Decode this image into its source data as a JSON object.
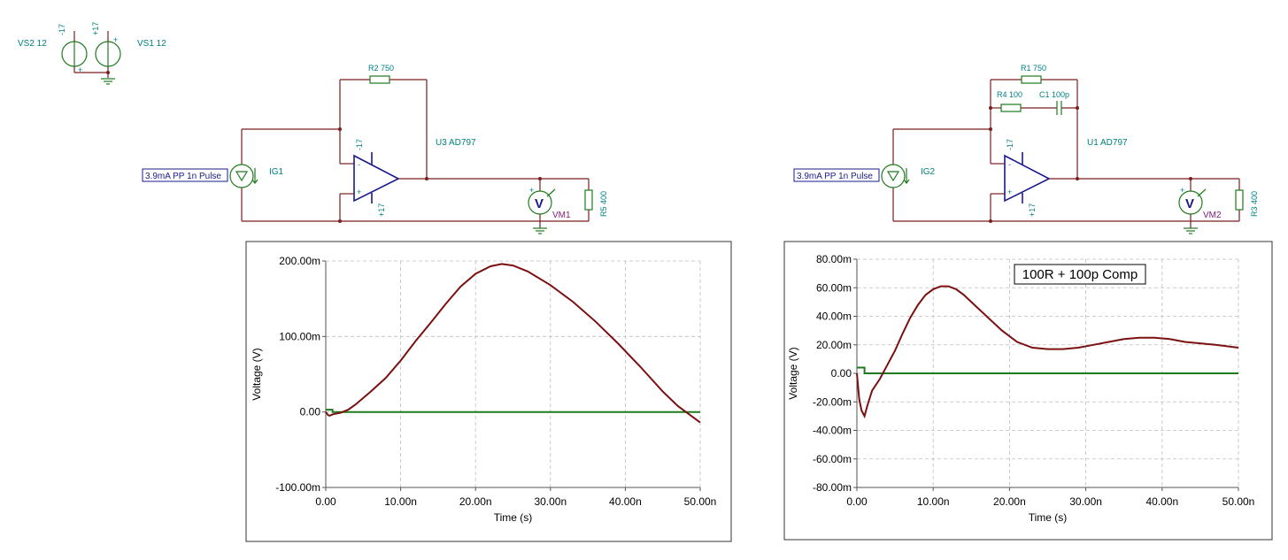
{
  "supplies": {
    "vs2_label": "VS2 12",
    "vs1_label": "VS1 12",
    "neg_rail": "-17",
    "pos_rail": "+17",
    "plus_sign": "+"
  },
  "circuit1": {
    "r2_label": "R2 750",
    "opamp_label": "U3 AD797",
    "opamp_neg_rail": "-17",
    "opamp_pos_rail": "+17",
    "source_label": "IG1",
    "source_box": "3.9mA PP 1n Pulse",
    "meter_label": "VM1",
    "meter_glyph": "V",
    "load_label": "R5 400",
    "minus_in": "-",
    "plus_in": "+"
  },
  "circuit2": {
    "r1_label": "R1 750",
    "r4_label": "R4 100",
    "c1_label": "C1 100p",
    "opamp_label": "U1 AD797",
    "opamp_neg_rail": "-17",
    "opamp_pos_rail": "+17",
    "source_label": "IG2",
    "source_box": "3.9mA PP 1n Pulse",
    "meter_label": "VM2",
    "meter_glyph": "V",
    "load_label": "R3 400",
    "minus_in": "-",
    "plus_in": "+"
  },
  "colors": {
    "trace_output": "#7a1010",
    "trace_input": "#1f7a1f",
    "wire": "#7a1f1f",
    "component": "#1f7a1f",
    "label": "#008080"
  },
  "chart_data": [
    {
      "type": "line",
      "xlabel": "Time (s)",
      "ylabel": "Voltage (V)",
      "xlim": [
        0,
        50
      ],
      "ylim": [
        -100,
        200
      ],
      "x_unit": "ns",
      "y_unit": "mV",
      "x_ticks": [
        "0.00",
        "10.00n",
        "20.00n",
        "30.00n",
        "40.00n",
        "50.00n"
      ],
      "y_ticks": [
        "-100.00m",
        "0.00",
        "100.00m",
        "200.00m"
      ],
      "grid": true,
      "series": [
        {
          "role": "output",
          "x": [
            0,
            0.3,
            0.5,
            1,
            2,
            3,
            4,
            6,
            8,
            10,
            12,
            14,
            16,
            18,
            20,
            22,
            23.5,
            25,
            27,
            30,
            33,
            36,
            39,
            42,
            45,
            47,
            48.5,
            50
          ],
          "y": [
            0,
            -4,
            -5,
            -3,
            -1,
            3,
            10,
            27,
            45,
            68,
            94,
            118,
            143,
            166,
            183,
            193,
            196,
            194,
            186,
            168,
            146,
            120,
            91,
            60,
            27,
            8,
            -3,
            -14
          ]
        },
        {
          "role": "input",
          "x": [
            0,
            0.9,
            0.9,
            50
          ],
          "y": [
            3,
            3,
            0,
            0
          ]
        }
      ]
    },
    {
      "type": "line",
      "xlabel": "Time (s)",
      "ylabel": "Voltage (V)",
      "xlim": [
        0,
        50
      ],
      "ylim": [
        -80,
        80
      ],
      "x_unit": "ns",
      "y_unit": "mV",
      "x_ticks": [
        "0.00",
        "10.00n",
        "20.00n",
        "30.00n",
        "40.00n",
        "50.00n"
      ],
      "y_ticks": [
        "-80.00m",
        "-60.00m",
        "-40.00m",
        "-20.00m",
        "0.00",
        "20.00m",
        "40.00m",
        "60.00m",
        "80.00m"
      ],
      "grid": true,
      "annotation": "100R + 100p Comp",
      "series": [
        {
          "role": "output",
          "x": [
            0,
            0.3,
            0.6,
            1.0,
            1.4,
            2,
            3,
            4,
            5,
            6,
            7,
            8,
            9,
            10,
            11,
            12,
            13,
            14,
            15,
            17,
            19,
            21,
            23,
            25,
            27,
            29,
            31,
            33,
            35,
            37,
            39,
            41,
            43,
            45,
            47,
            50
          ],
          "y": [
            0,
            -18,
            -26,
            -30,
            -22,
            -12,
            -4,
            6,
            16,
            28,
            39,
            48,
            55,
            59,
            61,
            61,
            59,
            55,
            50,
            40,
            30,
            22,
            18,
            17,
            17,
            18,
            20,
            22,
            24,
            25,
            25,
            24,
            22,
            21,
            20,
            18
          ]
        },
        {
          "role": "input",
          "x": [
            0,
            1.0,
            1.0,
            50
          ],
          "y": [
            4,
            4,
            0,
            0
          ]
        }
      ]
    }
  ]
}
